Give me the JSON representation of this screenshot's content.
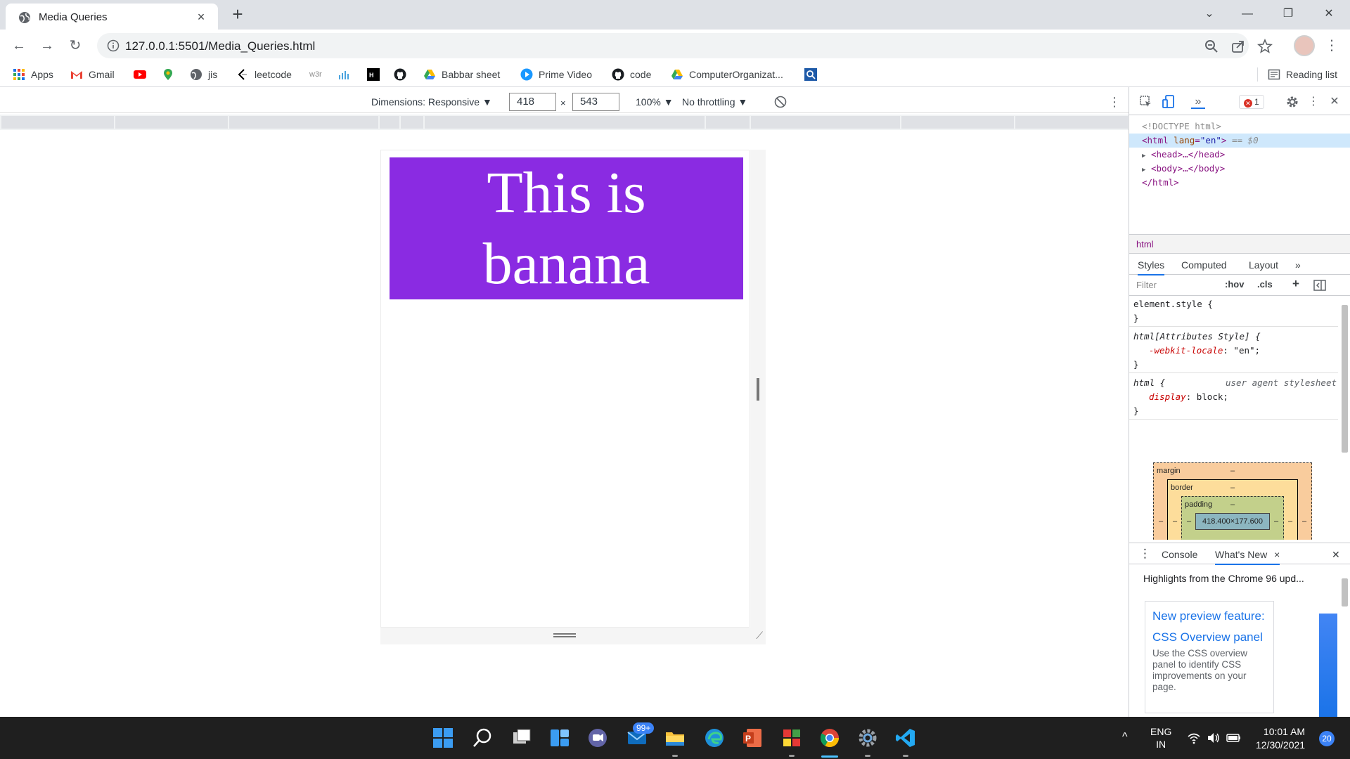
{
  "browser": {
    "tab": {
      "title": "Media Queries",
      "close": "×"
    },
    "new_tab": "+",
    "window": {
      "minimize": "—",
      "restore": "❐",
      "close": "✕",
      "tab_search": "⌄"
    },
    "url": "127.0.0.1:5501/Media_Queries.html",
    "nav": {
      "back": "←",
      "forward": "→",
      "reload": "↻"
    },
    "menu": "⋮"
  },
  "bookmarks": [
    {
      "label": "Apps",
      "icon": "apps-grid-icon"
    },
    {
      "label": "Gmail",
      "icon": "gmail-icon"
    },
    {
      "label": "",
      "icon": "youtube-icon"
    },
    {
      "label": "",
      "icon": "maps-pin-icon"
    },
    {
      "label": "jis",
      "icon": "globe-icon"
    },
    {
      "label": "leetcode",
      "icon": "leetcode-icon"
    },
    {
      "label": "w3r",
      "icon": "w3r-icon"
    },
    {
      "label": "",
      "icon": "analytics-icon"
    },
    {
      "label": "",
      "icon": "hackerrank-icon"
    },
    {
      "label": "",
      "icon": "github-icon"
    },
    {
      "label": "Babbar sheet",
      "icon": "drive-icon"
    },
    {
      "label": "Prime Video",
      "icon": "prime-video-icon"
    },
    {
      "label": "code",
      "icon": "github-icon"
    },
    {
      "label": "ComputerOrganizat...",
      "icon": "drive-icon"
    },
    {
      "label": "",
      "icon": "search-box-icon"
    }
  ],
  "reading_list": "Reading list",
  "device_toolbar": {
    "dimensions": "Dimensions: Responsive ▼",
    "width": "418",
    "times": "×",
    "height": "543",
    "zoom": "100% ▼",
    "throttling": "No throttling ▼",
    "more": "⋮"
  },
  "page": {
    "line1": "This is",
    "line2": "banana",
    "box_color": "#8a2be2"
  },
  "devtools": {
    "more_tabs": "»",
    "error_count": "1",
    "error_x": "✕",
    "tree": {
      "doctype": "<!DOCTYPE html>",
      "html_open": "<html",
      "lang_attr": "lang",
      "lang_val": "\"en\"",
      "html_close_bracket": ">",
      "selected_marker": "== $0",
      "head": "<head>…</head>",
      "body": "<body>…</body>",
      "html_end": "</html>"
    },
    "breadcrumb": "html",
    "tabs": {
      "styles": "Styles",
      "computed": "Computed",
      "layout": "Layout",
      "more": "»"
    },
    "filter_placeholder": "Filter",
    "hov": ":hov",
    "cls": ".cls",
    "plus": "+",
    "rules": [
      {
        "selector": "element.style {",
        "close": "}"
      },
      {
        "selector": "html[Attributes Style] {",
        "prop": "-webkit-locale",
        "value": "\"en\";",
        "close": "}"
      },
      {
        "selector": "html {",
        "origin": "user agent stylesheet",
        "prop": "display",
        "value": "block;",
        "close": "}"
      }
    ],
    "box_model": {
      "margin": "margin",
      "border": "border",
      "padding": "padding",
      "dash": "–",
      "content": "418.400×177.600"
    },
    "drawer": {
      "console": "Console",
      "whats_new": "What's New",
      "close_tab": "×",
      "close": "✕",
      "highlights": "Highlights from the Chrome 96 upd...",
      "card_title": "New preview feature: CSS Overview panel",
      "card_desc": "Use the CSS overview panel to identify CSS improvements on your page."
    }
  },
  "taskbar": {
    "badge": "99+",
    "lang_top": "ENG",
    "lang_bottom": "IN",
    "time": "10:01 AM",
    "date": "12/30/2021",
    "notifications": "20",
    "chevron": "^"
  }
}
